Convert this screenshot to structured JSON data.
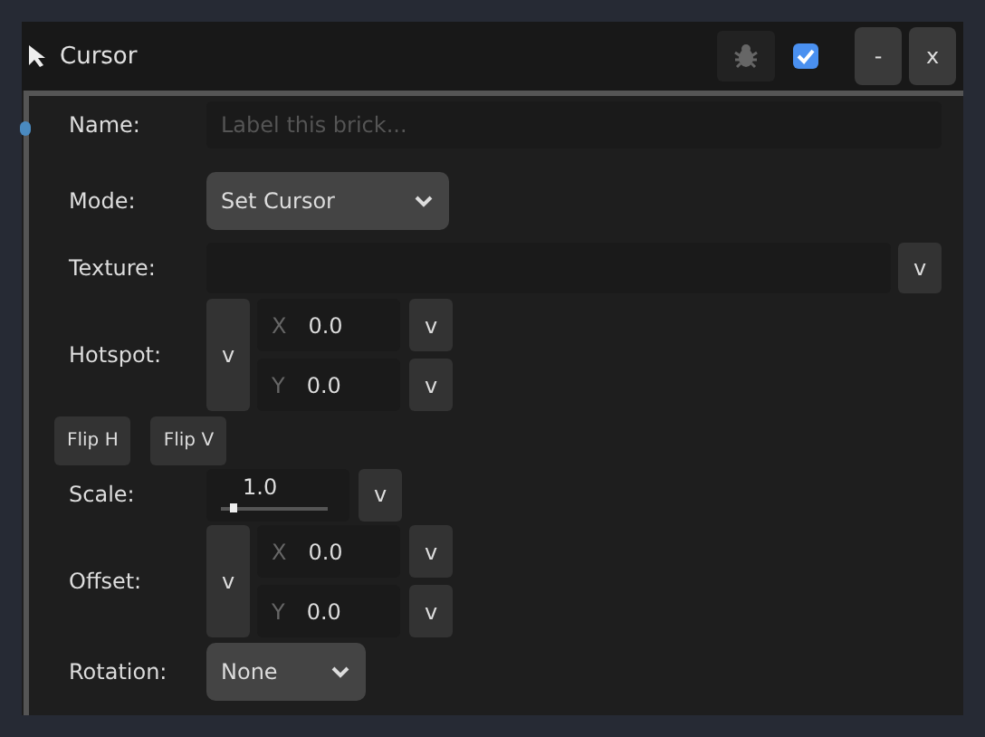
{
  "header": {
    "title": "Cursor",
    "enabled": true,
    "buttons": [
      "-",
      "x"
    ]
  },
  "name": {
    "label": "Name:",
    "placeholder": "Label this brick..."
  },
  "mode": {
    "label": "Mode:",
    "value": "Set Cursor"
  },
  "texture": {
    "label": "Texture:",
    "button": "v"
  },
  "hotspot": {
    "label": "Hotspot:",
    "button": "v",
    "fields": [
      {
        "axis": "X",
        "value": "0.0",
        "button": "v"
      },
      {
        "axis": "Y",
        "value": "0.0",
        "button": "v"
      }
    ]
  },
  "flips": [
    "Flip H",
    "Flip V"
  ],
  "scale": {
    "label": "Scale:",
    "value": "1.0",
    "level": 0.12,
    "button": "v"
  },
  "offset": {
    "label": "Offset:",
    "button": "v",
    "fields": [
      {
        "axis": "X",
        "value": "0.0",
        "button": "v"
      },
      {
        "axis": "Y",
        "value": "0.0",
        "button": "v"
      }
    ]
  },
  "rotation": {
    "label": "Rotation:",
    "value": "None"
  }
}
